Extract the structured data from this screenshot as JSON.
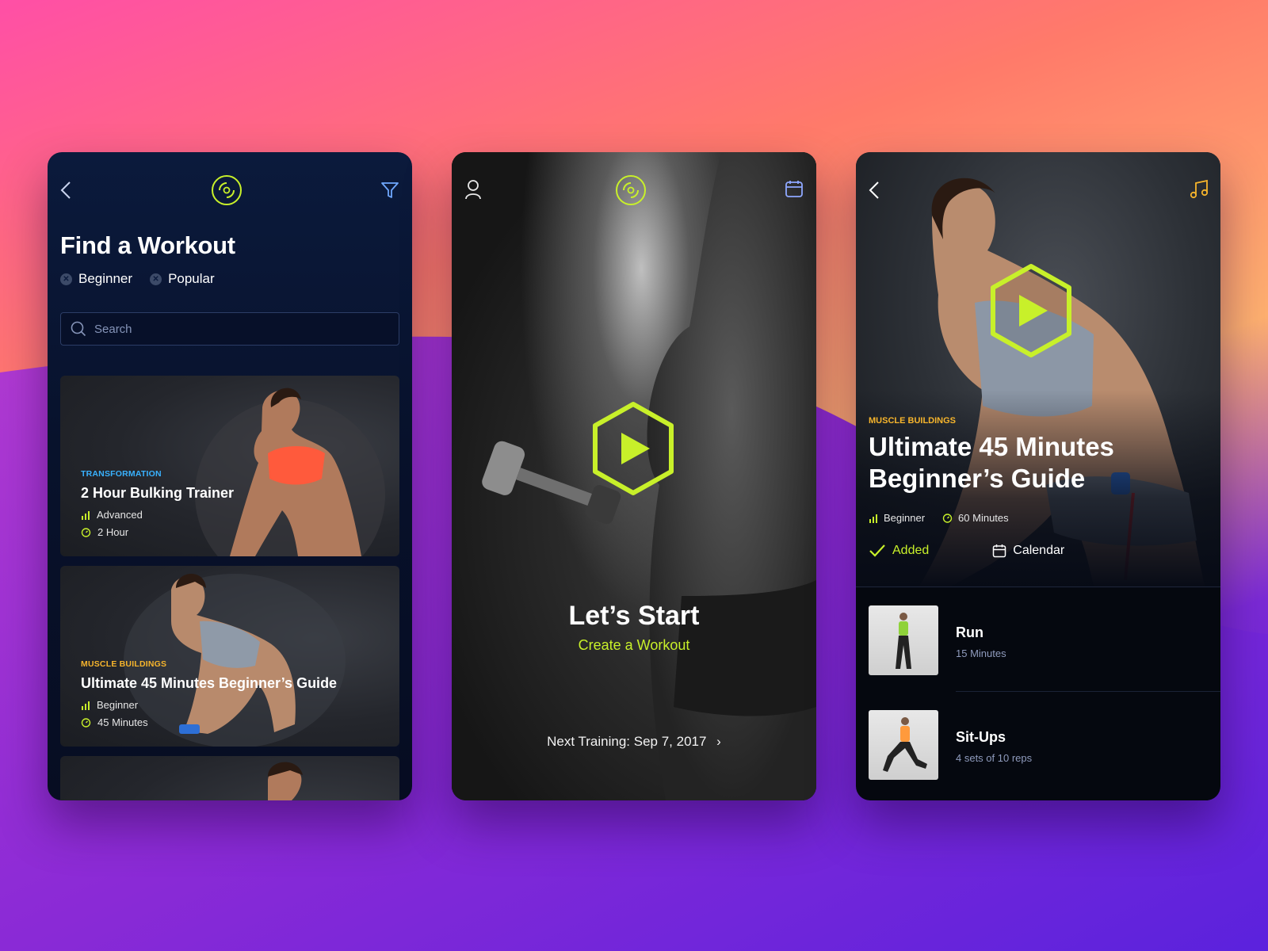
{
  "colors": {
    "accent": "#c8f02a",
    "blue_label": "#39b2ff",
    "orange_label": "#f7b52c",
    "muted": "#8f9bbd"
  },
  "screen1": {
    "icons": [
      "back-icon",
      "logo-icon",
      "filter-icon"
    ],
    "title": "Find a Workout",
    "chips": [
      "Beginner",
      "Popular"
    ],
    "search_placeholder": "Search",
    "cards": [
      {
        "category": "TRANSFORMATION",
        "title": "2 Hour Bulking Trainer",
        "level": "Advanced",
        "duration": "2 Hour"
      },
      {
        "category": "MUSCLE BUILDINGS",
        "title": "Ultimate 45 Minutes Beginner’s Guide",
        "level": "Beginner",
        "duration": "45 Minutes"
      }
    ]
  },
  "screen2": {
    "icons": [
      "profile-icon",
      "logo-icon",
      "calendar-icon"
    ],
    "heading": "Let’s Start",
    "cta": "Create a Workout",
    "next_training": "Next Training: Sep 7, 2017"
  },
  "screen3": {
    "icons": [
      "back-icon",
      "music-icon"
    ],
    "category": "MUSCLE BUILDINGS",
    "title": "Ultimate 45 Minutes Beginner’s Guide",
    "level": "Beginner",
    "duration": "60 Minutes",
    "added_label": "Added",
    "calendar_label": "Calendar",
    "exercises": [
      {
        "name": "Run",
        "detail": "15 Minutes"
      },
      {
        "name": "Sit-Ups",
        "detail": "4 sets of 10 reps"
      }
    ]
  }
}
